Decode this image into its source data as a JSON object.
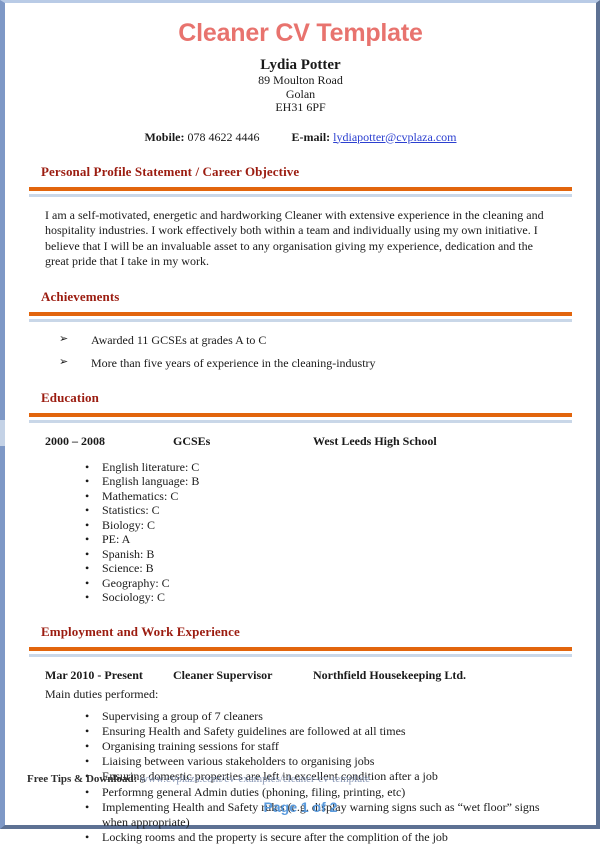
{
  "document": {
    "title": "Cleaner CV Template",
    "page_label": "Page 1 of 2"
  },
  "header": {
    "name": "Lydia Potter",
    "address": [
      "89 Moulton Road",
      "Golan",
      "EH31 6PF"
    ],
    "mobile_label": "Mobile:",
    "mobile_value": "078 4622 4446",
    "email_label": "E-mail:",
    "email_value": "lydiapotter@cvplaza.com"
  },
  "sections": {
    "profile": {
      "heading": "Personal Profile Statement / Career Objective",
      "body": "I am a self-motivated, energetic and hardworking Cleaner with extensive experience in the cleaning and hospitality industries. I work effectively both within a team and individually using my own initiative. I believe that I will be an invaluable asset to any organisation giving my experience, dedication and the great pride that I take in my work."
    },
    "achievements": {
      "heading": "Achievements",
      "items": [
        "Awarded 11 GCSEs at grades A to C",
        "More than five years of experience in the cleaning-industry"
      ]
    },
    "education": {
      "heading": "Education",
      "entry": {
        "dates": "2000 – 2008",
        "qualification": "GCSEs",
        "institution": "West Leeds High School"
      },
      "subjects": [
        "English literature: C",
        "English language: B",
        "Mathematics: C",
        "Statistics: C",
        "Biology: C",
        "PE: A",
        "Spanish: B",
        "Science: B",
        "Geography: C",
        "Sociology: C"
      ]
    },
    "employment": {
      "heading": "Employment and Work Experience",
      "entry": {
        "dates": "Mar 2010 - Present",
        "role": "Cleaner Supervisor",
        "employer": "Northfield Housekeeping Ltd."
      },
      "duties_label": "Main duties performed:",
      "duties": [
        "Supervising a group of 7 cleaners",
        "Ensuring Health and Safety guidelines are followed at all times",
        "Organising training sessions for staff",
        "Liaising between various stakeholders to organising jobs",
        "Ensuring domestic properties are left in excellent condition after a job",
        "Performng general Admin duties (phoning, filing, printing, etc)",
        "Implementing Health and Safety rules (e.g. display warning signs such as “wet floor” signs when appropriate)",
        "Locking rooms and the property is secure after the complition of the job"
      ]
    }
  },
  "footer": {
    "tip_label": "Free Tips & Download:",
    "tip_url": "www.cvplaza.com/cv-examples/cleaner-cv-template"
  },
  "icons": {
    "arrow_bullet": "➢",
    "dot_bullet": "•"
  },
  "colors": {
    "title": "#e8736e",
    "section_heading": "#9b1c10",
    "rule_orange": "#e2650d",
    "rule_blue": "#c9d7e8",
    "link": "#2b3fd0",
    "page_number": "#5b9bdd",
    "border_left": "#7e98c6",
    "border_right": "#5d7193"
  }
}
